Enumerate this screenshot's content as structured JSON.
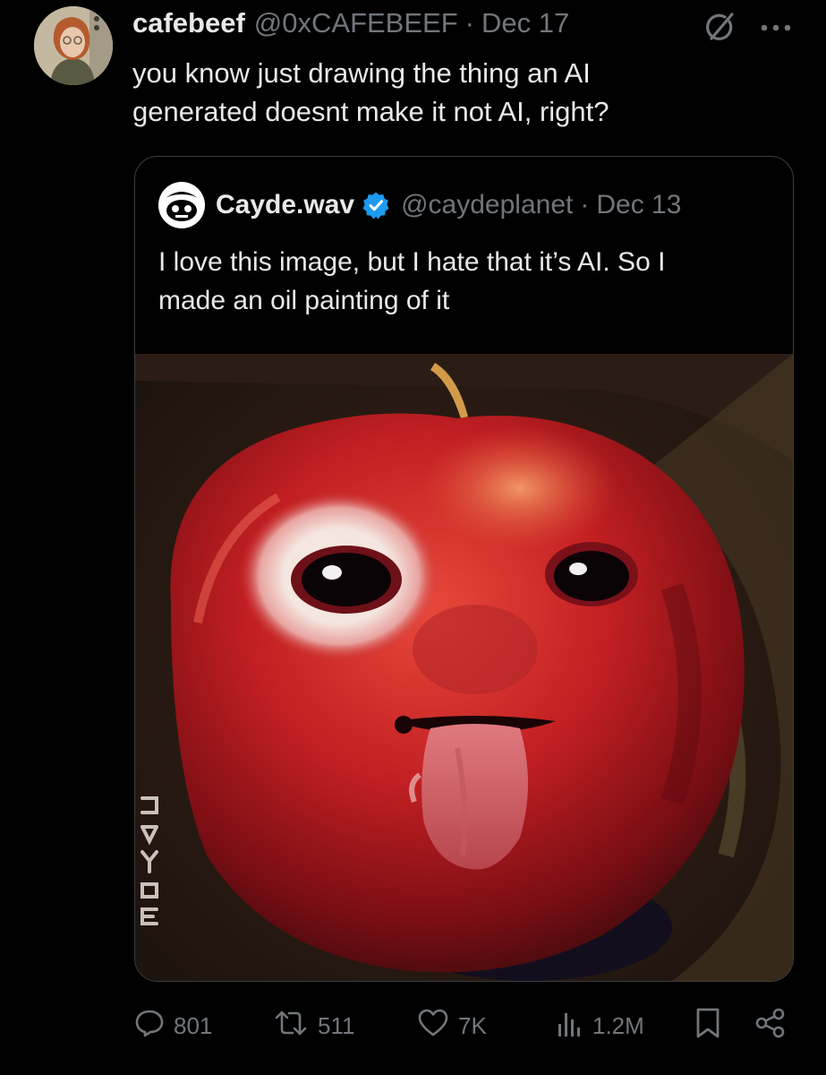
{
  "post": {
    "author_name": "cafebeef",
    "author_handle": "@0xCAFEBEEF",
    "separator": "·",
    "date": "Dec 17",
    "text_lines": [
      "you know just drawing the thing an AI",
      "generated doesnt make it not AI, right?"
    ],
    "icons": {
      "grok": "grok-icon",
      "more": "more-dots-icon"
    }
  },
  "quoted_post": {
    "author_name": "Cayde.wav",
    "verified": true,
    "author_handle": "@caydeplanet",
    "separator": "·",
    "date": "Dec 13",
    "text_lines": [
      "I love this image, but I hate that it’s AI. So I",
      "made an oil painting of it"
    ],
    "image_signature": "CAYDE"
  },
  "actions": {
    "replies": "801",
    "reposts": "511",
    "likes": "7K",
    "views": "1.2M"
  },
  "colors": {
    "background": "#000000",
    "text_primary": "#e7e9ea",
    "text_secondary": "#71767b",
    "border": "#3a3d40",
    "verified": "#1d9bf0"
  }
}
